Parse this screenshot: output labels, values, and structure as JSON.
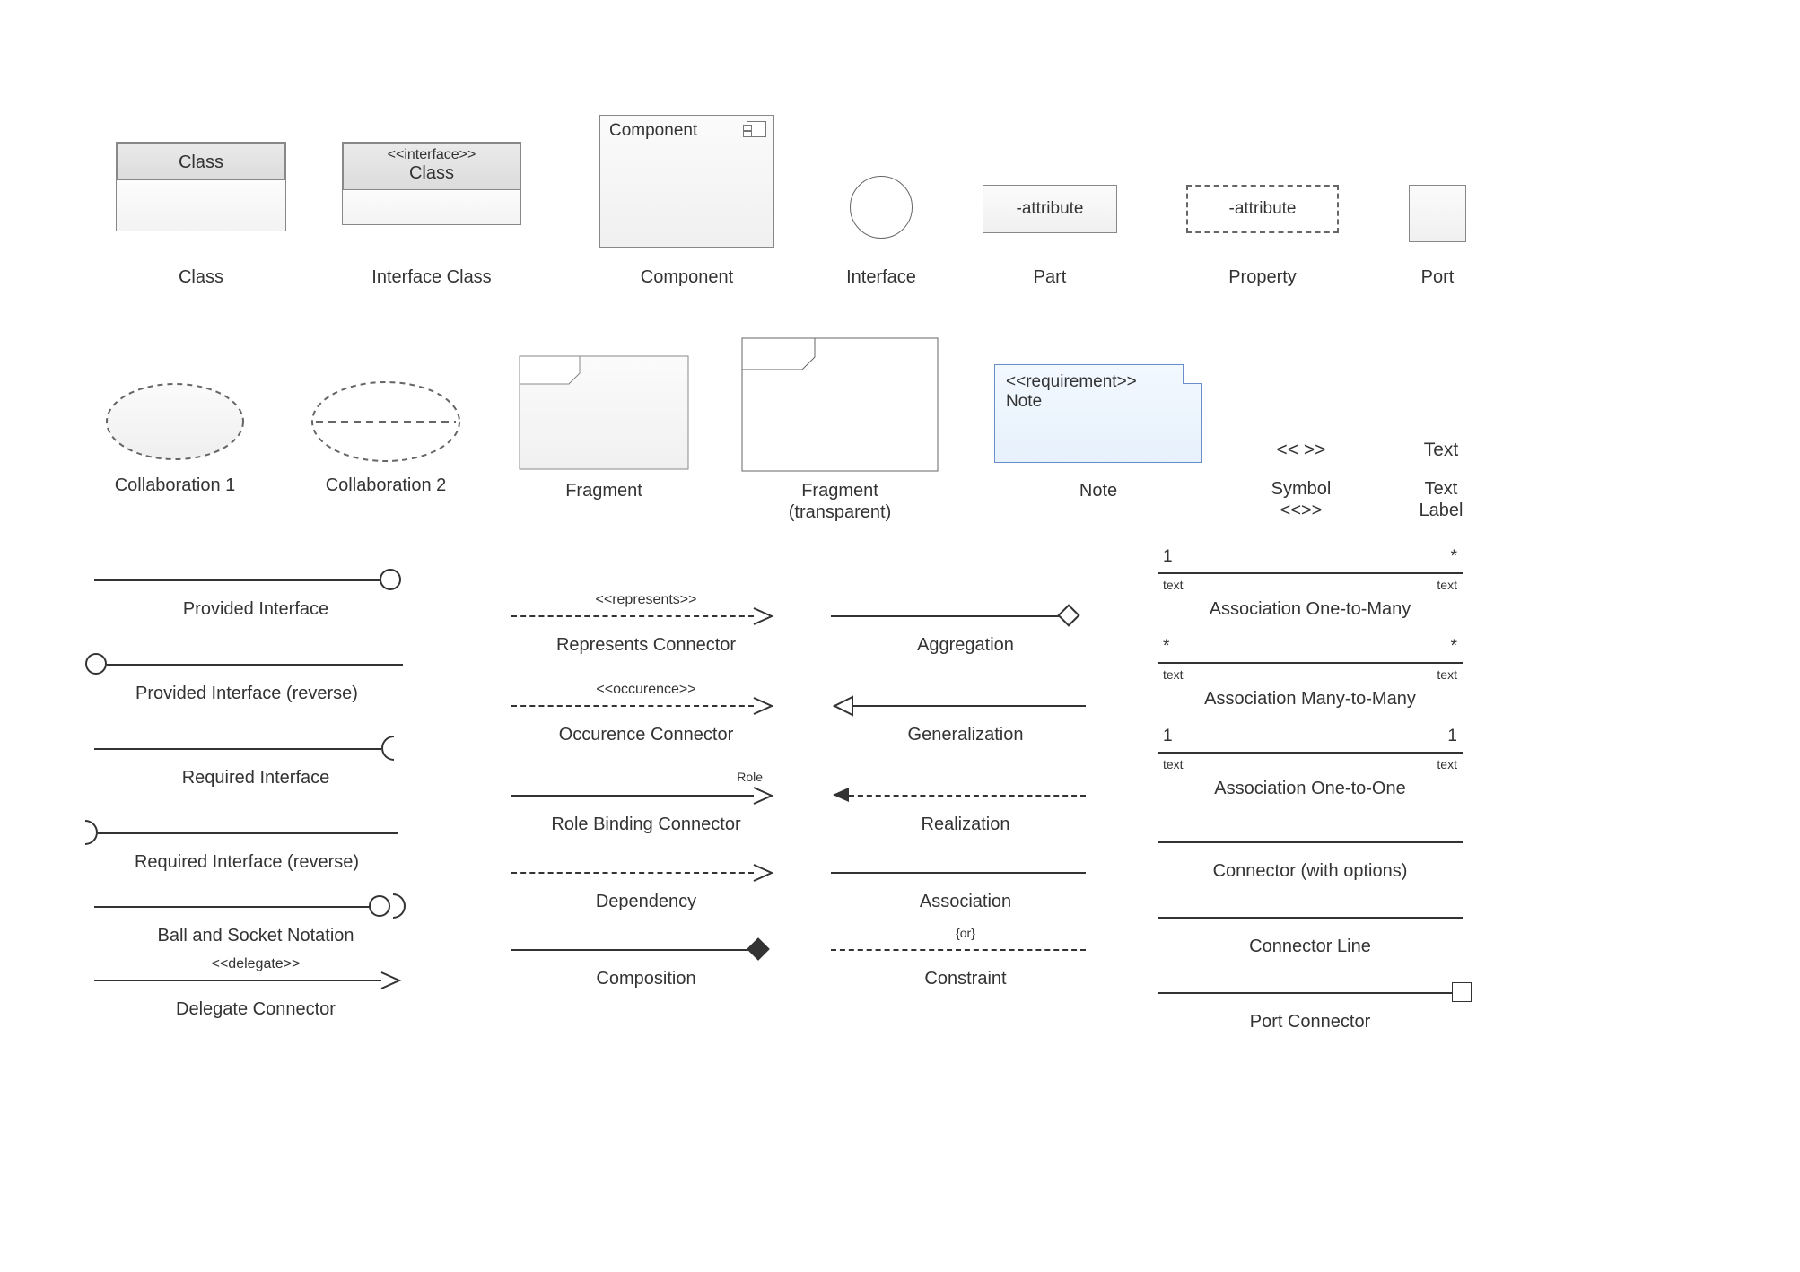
{
  "row1": {
    "class": {
      "header": "Class",
      "caption": "Class"
    },
    "interface": {
      "stereo": "<<interface>>",
      "header": "Class",
      "caption": "Interface Class"
    },
    "component": {
      "title": "Component",
      "caption": "Component"
    },
    "interfaceCircle": {
      "caption": "Interface"
    },
    "part": {
      "text": "-attribute",
      "caption": "Part"
    },
    "property": {
      "text": "-attribute",
      "caption": "Property"
    },
    "port": {
      "caption": "Port"
    }
  },
  "row2": {
    "collab1": {
      "caption": "Collaboration 1"
    },
    "collab2": {
      "caption": "Collaboration 2"
    },
    "fragment": {
      "caption": "Fragment"
    },
    "fragmentT": {
      "caption1": "Fragment",
      "caption2": "(transparent)"
    },
    "note": {
      "stereo": "<<requirement>>",
      "text": "Note",
      "caption": "Note"
    },
    "symbol": {
      "glyph": "<< >>",
      "caption1": "Symbol",
      "caption2": "<<>>"
    },
    "textlabel": {
      "glyph": "Text",
      "caption1": "Text",
      "caption2": "Label"
    }
  },
  "col1": {
    "provided": "Provided Interface",
    "providedRev": "Provided Interface (reverse)",
    "required": "Required Interface",
    "requiredRev": "Required Interface (reverse)",
    "ballsocket": "Ball and Socket Notation",
    "delegateTag": "<<delegate>>",
    "delegate": "Delegate Connector"
  },
  "col2": {
    "representsTag": "<<represents>>",
    "represents": "Represents Connector",
    "occurenceTag": "<<occurence>>",
    "occurence": "Occurence Connector",
    "roleTag": "Role",
    "rolebind": "Role Binding Connector",
    "dependency": "Dependency",
    "composition": "Composition"
  },
  "col3": {
    "aggregation": "Aggregation",
    "generalization": "Generalization",
    "realization": "Realization",
    "association": "Association",
    "constraintTag": "{or}",
    "constraint": "Constraint"
  },
  "col4": {
    "a1m": {
      "left": "1",
      "right": "*",
      "leftT": "text",
      "rightT": "text",
      "caption": "Association One-to-Many"
    },
    "amm": {
      "left": "*",
      "right": "*",
      "leftT": "text",
      "rightT": "text",
      "caption": "Association Many-to-Many"
    },
    "a11": {
      "left": "1",
      "right": "1",
      "leftT": "text",
      "rightT": "text",
      "caption": "Association One-to-One"
    },
    "connOpts": "Connector (with options)",
    "connLine": "Connector Line",
    "portConn": "Port Connector"
  }
}
